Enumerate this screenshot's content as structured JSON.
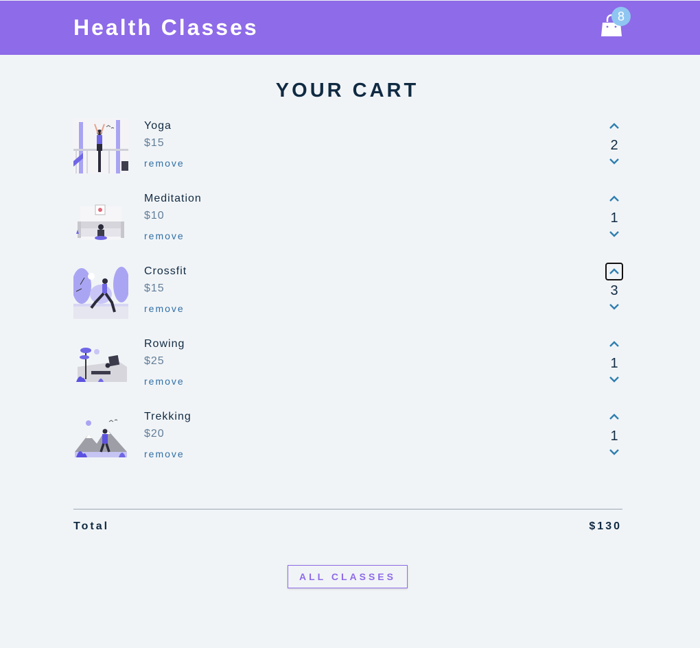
{
  "header": {
    "title": "Health Classes",
    "cart_count": "8",
    "cart_icon": "shopping-bag-icon"
  },
  "cart": {
    "title": "YOUR CART",
    "remove_label": "remove",
    "items": [
      {
        "name": "Yoga",
        "price": "$15",
        "quantity": "2"
      },
      {
        "name": "Meditation",
        "price": "$10",
        "quantity": "1"
      },
      {
        "name": "Crossfit",
        "price": "$15",
        "quantity": "3"
      },
      {
        "name": "Rowing",
        "price": "$25",
        "quantity": "1"
      },
      {
        "name": "Trekking",
        "price": "$20",
        "quantity": "1"
      }
    ],
    "total_label": "Total",
    "total_value": "$130",
    "all_classes_label": "ALL CLASSES"
  },
  "colors": {
    "accent": "#8e6be8",
    "badge": "#8fc5f1",
    "text_dark": "#102a42",
    "price_grey": "#617d98",
    "link_blue": "#2f6fa6",
    "background": "#f1f4f7"
  }
}
